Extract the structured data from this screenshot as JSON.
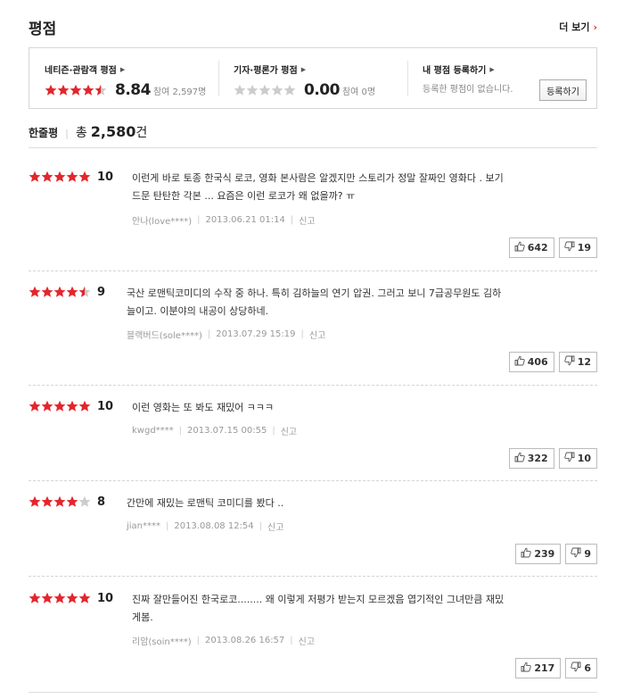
{
  "title": "평점",
  "more_label": "더 보기",
  "colors": {
    "star_on": "#e3262c",
    "star_off": "#cccccc"
  },
  "scores": {
    "netizen": {
      "label": "네티즌·관람객 평점",
      "rating_stars": 4.5,
      "score": "8.84",
      "participants": "참여 2,597명"
    },
    "critic": {
      "label": "기자·평론가 평점",
      "rating_stars": 0,
      "score": "0.00",
      "participants": "참여 0명"
    },
    "mine": {
      "label": "내 평점 등록하기",
      "desc": "등록한 평점이 없습니다.",
      "button": "등록하기"
    }
  },
  "summary": {
    "label": "한줄평",
    "total_prefix": "총",
    "count": "2,580",
    "unit": "건"
  },
  "reviews": [
    {
      "stars": 5,
      "score": "10",
      "line1": "이런게 바로 토종 한국식 로코, 영화 본사람은 알겠지만 스토리가 정말 잘짜인 영화다 . 보기",
      "line2": "드문 탄탄한 각본 ... 요즘은 이런 로코가 왜 없을까? ㅠ",
      "user": "안나(love****)",
      "date": "2013.06.21 01:14",
      "report": "신고",
      "up": "642",
      "down": "19"
    },
    {
      "stars": 4.5,
      "score": "9",
      "line1": "국산 로맨틱코미디의 수작 중 하나. 특히 김하늘의 연기 압권. 그러고 보니 7급공무원도 김하",
      "line2": "늘이고. 이분야의 내공이 상당하네.",
      "user": "블랙버드(sole****)",
      "date": "2013.07.29 15:19",
      "report": "신고",
      "up": "406",
      "down": "12"
    },
    {
      "stars": 5,
      "score": "10",
      "line1": "이런 영화는 또 봐도 재밌어 ㅋㅋㅋ",
      "line2": "",
      "user": "kwgd****",
      "date": "2013.07.15 00:55",
      "report": "신고",
      "up": "322",
      "down": "10"
    },
    {
      "stars": 4,
      "score": "8",
      "line1": "간만에 재밌는 로맨틱 코미디를 봤다 ..",
      "line2": "",
      "user": "jian****",
      "date": "2013.08.08 12:54",
      "report": "신고",
      "up": "239",
      "down": "9"
    },
    {
      "stars": 5,
      "score": "10",
      "line1": "진짜 잘만들어진 한국로코........ 왜 이렇게 저평가 받는지 모르겠음 엽기적인 그녀만큼 재밌",
      "line2": "게봄.",
      "user": "리암(soin****)",
      "date": "2013.08.26 16:57",
      "report": "신고",
      "up": "217",
      "down": "6"
    }
  ]
}
